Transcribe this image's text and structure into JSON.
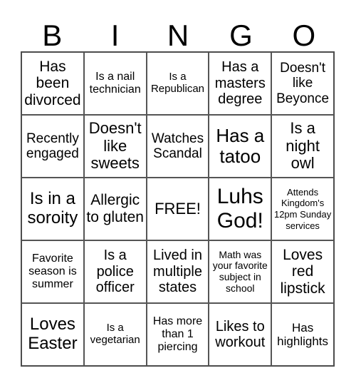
{
  "header": [
    "B",
    "I",
    "N",
    "G",
    "O"
  ],
  "cells": [
    "Has been divorced",
    "Is a nail technician",
    "Is a Republican",
    "Has a masters degree",
    "Doesn't like Beyonce",
    "Recently engaged",
    "Doesn't like sweets",
    "Watches Scandal",
    "Has a tatoo",
    "Is a night owl",
    "Is in a soroity",
    "Allergic to gluten",
    "FREE!",
    "Luhs God!",
    "Attends Kingdom's 12pm Sunday services",
    "Favorite season is summer",
    "Is a police officer",
    "Lived in multiple states",
    "Math was your favorite subject in school",
    "Loves red lipstick",
    "Loves Easter",
    "Is a vegetarian",
    "Has more than 1 piercing",
    "Likes to workout",
    "Has highlights"
  ]
}
